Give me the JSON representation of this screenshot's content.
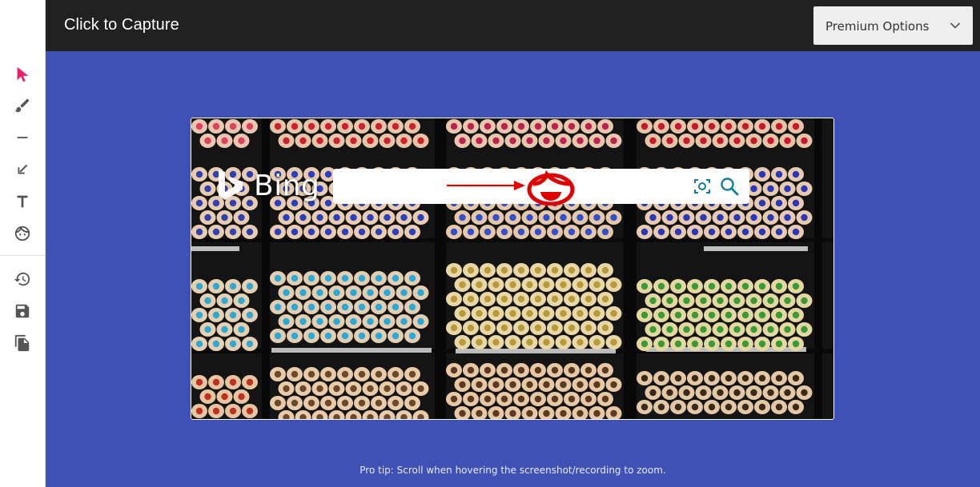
{
  "header": {
    "title": "Click to Capture",
    "premium_select_label": "Premium Options"
  },
  "toolbar": {
    "tools": [
      {
        "icon": "cursor-icon",
        "color": "#e91e63"
      },
      {
        "icon": "brush-icon"
      },
      {
        "icon": "line-icon"
      },
      {
        "icon": "arrow-icon"
      },
      {
        "icon": "text-icon"
      },
      {
        "icon": "face-blur-icon"
      },
      {
        "icon": "history-icon"
      },
      {
        "icon": "save-icon"
      },
      {
        "icon": "copy-icon"
      }
    ]
  },
  "capture": {
    "bing_logo_text": "Bing",
    "annotations": [
      "red-arrow",
      "red-face-sticker"
    ]
  },
  "footer": {
    "pro_tip": "Pro tip: Scroll when hovering the screenshot/recording to zoom."
  },
  "colors": {
    "header_bg": "#212121",
    "stage_bg": "#3f51b5",
    "accent": "#e91e63",
    "annotation_red": "#e10000"
  }
}
